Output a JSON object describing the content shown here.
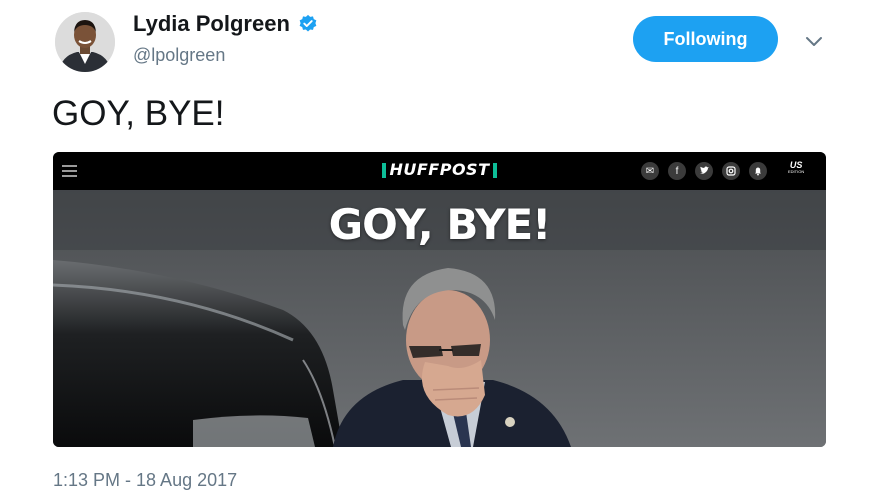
{
  "author": {
    "name": "Lydia Polgreen",
    "handle": "@lpolgreen",
    "verified": true
  },
  "follow_button": {
    "label": "Following",
    "color": "#1da1f2"
  },
  "more_menu": {
    "icon": "chevron-down-icon"
  },
  "tweet": {
    "text": "GOY, BYE!",
    "timestamp": "1:13 PM - 18 Aug 2017"
  },
  "media": {
    "site_brand": "HUFFPOST",
    "brand_accent": "#0dbe98",
    "headline": "GOY, BYE!",
    "edition_label": "US",
    "edition_sub": "EDITION",
    "social_icons": [
      "mail-icon",
      "facebook-icon",
      "twitter-icon",
      "instagram-icon",
      "bell-icon"
    ]
  }
}
